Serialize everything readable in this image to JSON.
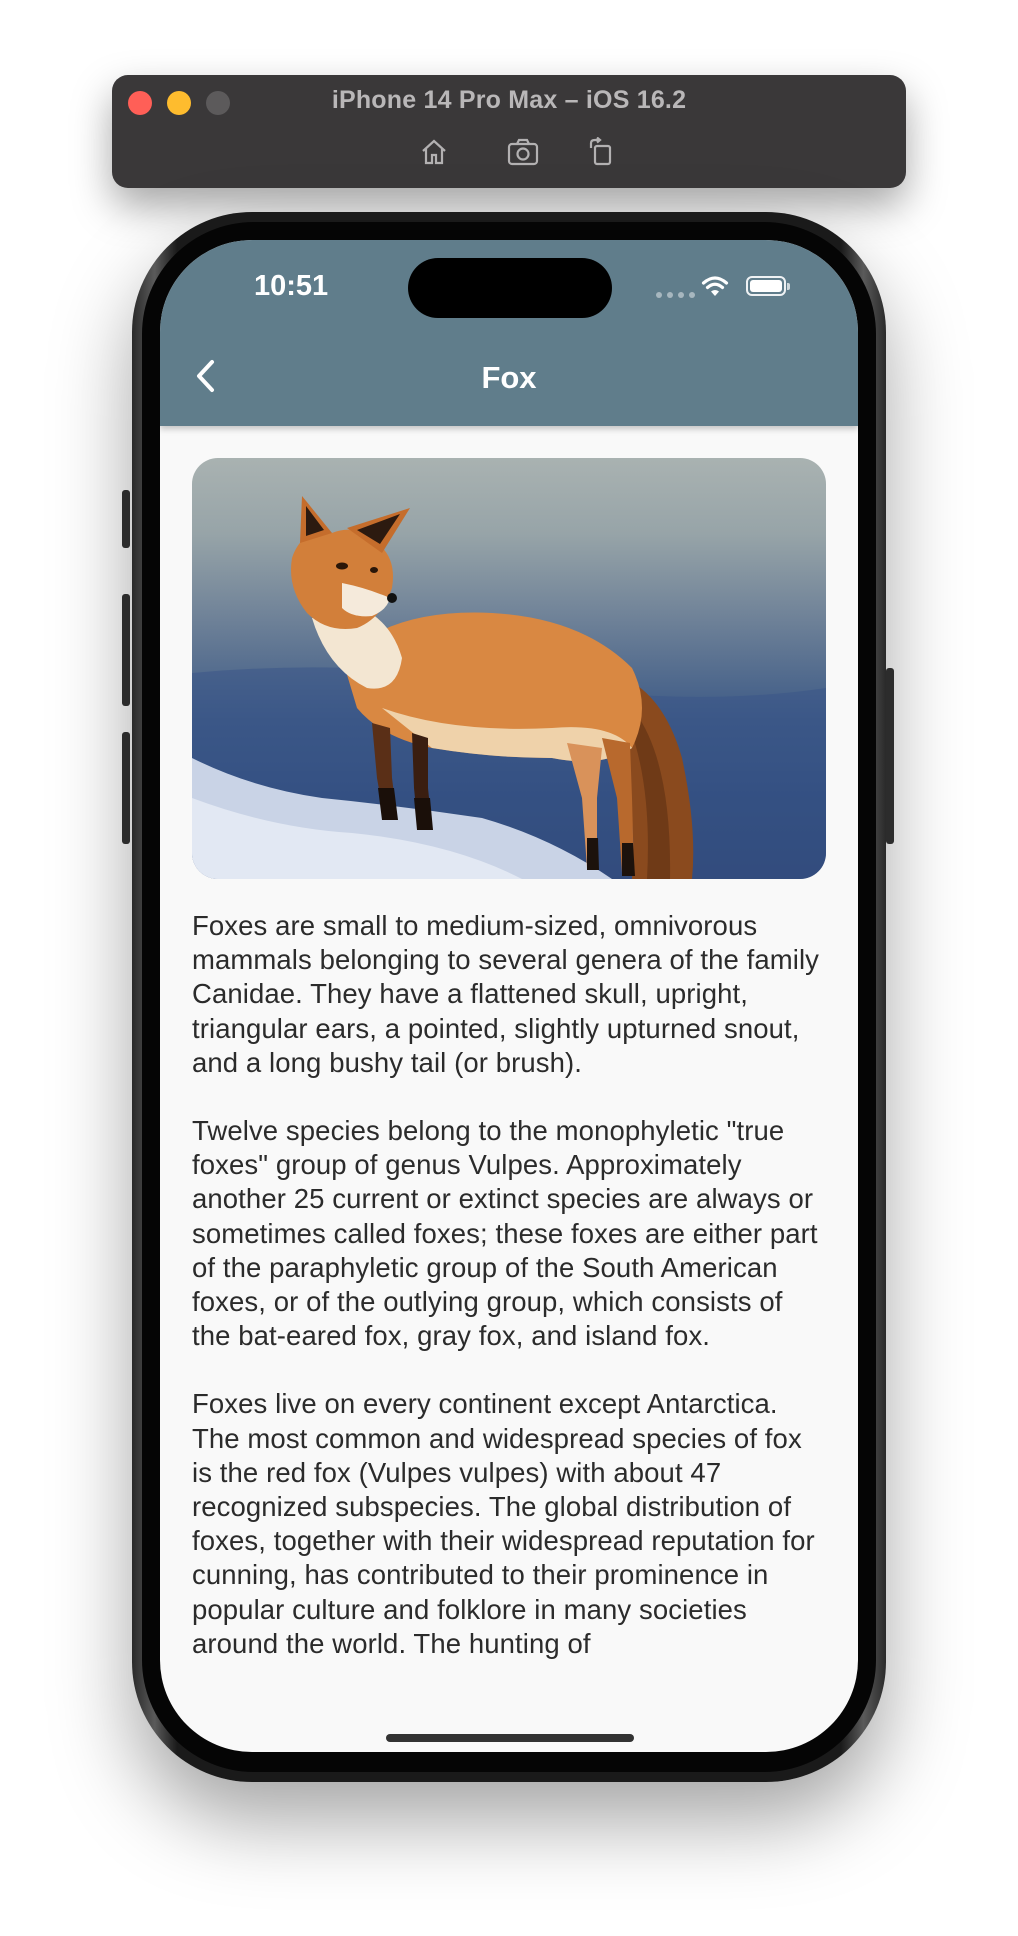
{
  "simulator": {
    "title": "iPhone 14 Pro Max – iOS 16.2",
    "tools": [
      "home-icon",
      "screenshot-icon",
      "rotate-icon"
    ]
  },
  "status_bar": {
    "time": "10:51"
  },
  "app_bar": {
    "title": "Fox",
    "background_color": "#607d8b"
  },
  "hero_image": {
    "subject": "red fox standing on snow"
  },
  "article": {
    "paragraphs": [
      "Foxes are small to medium-sized, omnivorous mammals belonging to several genera of the family Canidae. They have a flattened skull, upright, triangular ears, a pointed, slightly upturned snout, and a long bushy tail (or brush).",
      "Twelve species belong to the monophyletic \"true foxes\" group of genus Vulpes. Approximately another 25 current or extinct species are always or sometimes called foxes; these foxes are either part of the paraphyletic group of the South American foxes, or of the outlying group, which consists of the bat-eared fox, gray fox, and island fox.",
      "Foxes live on every continent except Antarctica. The most common and widespread species of fox is the red fox (Vulpes vulpes) with about 47 recognized subspecies. The global distribution of foxes, together with their widespread reputation for cunning, has contributed to their prominence in popular culture and folklore in many societies around the world. The hunting of"
    ]
  }
}
